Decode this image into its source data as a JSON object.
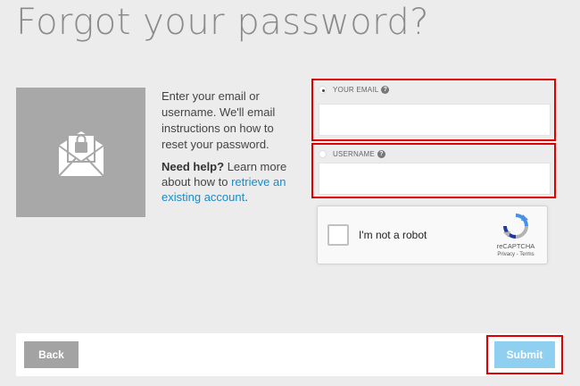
{
  "page": {
    "title": "Forgot your password?"
  },
  "intro": {
    "text": "Enter your email or username. We'll email instructions on how to reset your password."
  },
  "help": {
    "bold": "Need help?",
    "text": " Learn more about how to ",
    "link": "retrieve an existing account",
    "end": "."
  },
  "email_field": {
    "label": "YOUR EMAIL",
    "selected": true,
    "value": "",
    "help_icon": "question-icon"
  },
  "username_field": {
    "label": "USERNAME",
    "selected": false,
    "value": "",
    "help_icon": "question-icon"
  },
  "captcha": {
    "label": "I'm not a robot",
    "brand": "reCAPTCHA",
    "links": "Privacy - Terms"
  },
  "buttons": {
    "back": "Back",
    "submit": "Submit"
  },
  "colors": {
    "link": "#1a8bc8",
    "highlight_border": "#e00000",
    "submit_bg": "#8fd0f0",
    "back_bg": "#a3a3a3"
  },
  "icons": {
    "hero": "envelope-lock-icon",
    "captcha_logo": "recaptcha-icon"
  }
}
